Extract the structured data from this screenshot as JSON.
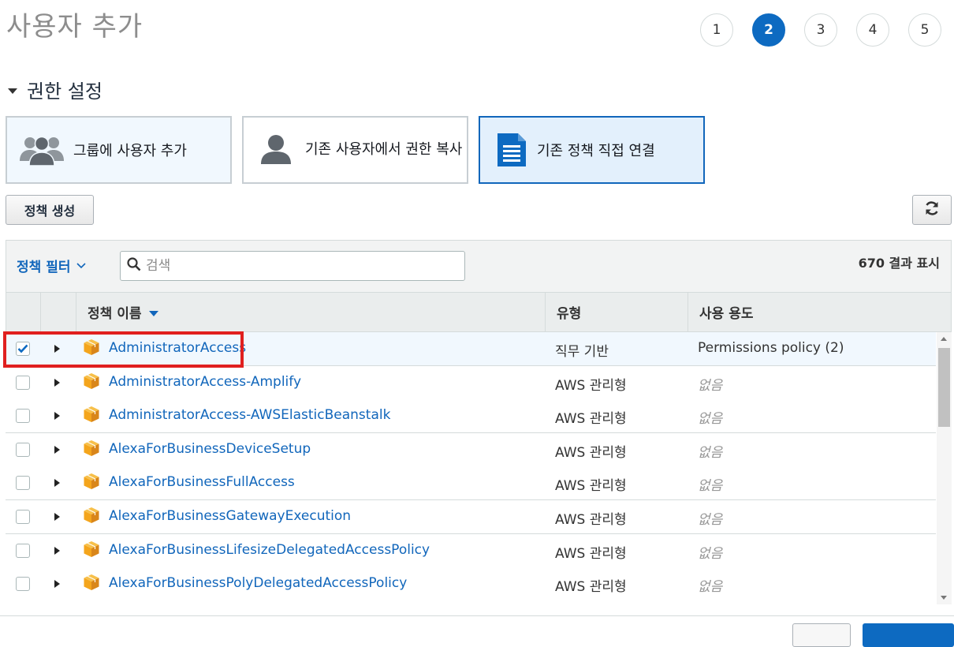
{
  "page": {
    "title": "사용자 추가"
  },
  "steps": [
    {
      "label": "1",
      "active": false
    },
    {
      "label": "2",
      "active": true
    },
    {
      "label": "3",
      "active": false
    },
    {
      "label": "4",
      "active": false
    },
    {
      "label": "5",
      "active": false
    }
  ],
  "section": {
    "title": "권한 설정"
  },
  "options": [
    {
      "label": "그룹에 사용자 추가",
      "icon": "group-icon",
      "selected": false
    },
    {
      "label": "기존 사용자에서 권한 복사",
      "icon": "user-icon",
      "selected": false
    },
    {
      "label": "기존 정책 직접 연결",
      "icon": "document-icon",
      "selected": true
    }
  ],
  "toolbar": {
    "create_policy_label": "정책 생성",
    "refresh_icon": "refresh-icon"
  },
  "filter": {
    "label": "정책 필터",
    "search_placeholder": "검색",
    "result_count": "670 결과 표시"
  },
  "table": {
    "columns": {
      "name": "정책 이름",
      "type": "유형",
      "usage": "사용 용도"
    },
    "rows": [
      {
        "name": "AdministratorAccess",
        "type": "직무 기반",
        "usage": "Permissions policy (2)",
        "checked": true
      },
      {
        "name": "AdministratorAccess-Amplify",
        "type": "AWS 관리형",
        "usage": "없음",
        "checked": false
      },
      {
        "name": "AdministratorAccess-AWSElasticBeanstalk",
        "type": "AWS 관리형",
        "usage": "없음",
        "checked": false
      },
      {
        "name": "AlexaForBusinessDeviceSetup",
        "type": "AWS 관리형",
        "usage": "없음",
        "checked": false
      },
      {
        "name": "AlexaForBusinessFullAccess",
        "type": "AWS 관리형",
        "usage": "없음",
        "checked": false
      },
      {
        "name": "AlexaForBusinessGatewayExecution",
        "type": "AWS 관리형",
        "usage": "없음",
        "checked": false
      },
      {
        "name": "AlexaForBusinessLifesizeDelegatedAccessPolicy",
        "type": "AWS 관리형",
        "usage": "없음",
        "checked": false
      },
      {
        "name": "AlexaForBusinessPolyDelegatedAccessPolicy",
        "type": "AWS 관리형",
        "usage": "없음",
        "checked": false
      }
    ]
  },
  "colors": {
    "accent": "#0d6ac1",
    "link": "#1166bb",
    "highlight": "#e0201f",
    "package": "#f4a51c"
  }
}
